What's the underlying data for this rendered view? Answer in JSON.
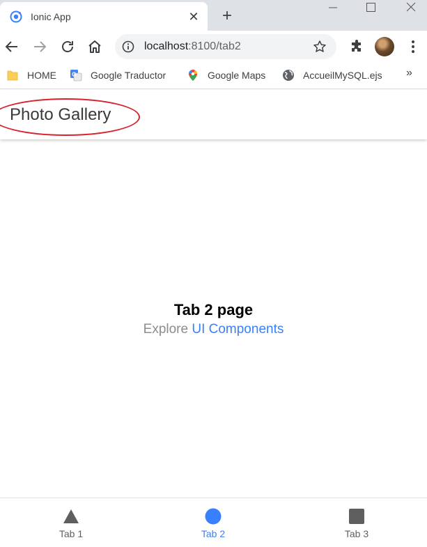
{
  "browser": {
    "tab": {
      "title": "Ionic App",
      "close_label": "✕"
    },
    "new_tab_label": "+",
    "window_controls": {
      "minimize": "—",
      "maximize": "☐",
      "close": "✕"
    },
    "toolbar": {
      "url_host": "localhost",
      "url_path": ":8100/tab2",
      "icons": [
        "back-arrow-icon",
        "forward-arrow-icon",
        "reload-icon",
        "home-icon",
        "info-icon",
        "star-icon",
        "extensions-puzzle-icon",
        "profile-avatar",
        "more-menu-icon"
      ]
    },
    "bookmarks": [
      {
        "label": "HOME",
        "icon": "folder-icon"
      },
      {
        "label": "Google Traductor",
        "icon": "google-translate-icon"
      },
      {
        "label": "Google Maps",
        "icon": "google-maps-pin-icon"
      },
      {
        "label": "AccueilMySQL.ejs",
        "icon": "globe-icon"
      }
    ],
    "bookmarks_more_label": "»"
  },
  "app": {
    "header_title": "Photo Gallery",
    "content": {
      "heading": "Tab 2 page",
      "text_prefix": "Explore",
      "link_text": "UI Components"
    },
    "tabs": [
      {
        "label": "Tab 1",
        "icon": "triangle-icon",
        "selected": false
      },
      {
        "label": "Tab 2",
        "icon": "ellipse-icon",
        "selected": true
      },
      {
        "label": "Tab 3",
        "icon": "square-icon",
        "selected": false
      }
    ]
  },
  "colors": {
    "accent": "#3880ff",
    "annotation": "#d9202b",
    "tab_strip": "#dee1e6",
    "icon_gray": "#5f5f5f"
  }
}
